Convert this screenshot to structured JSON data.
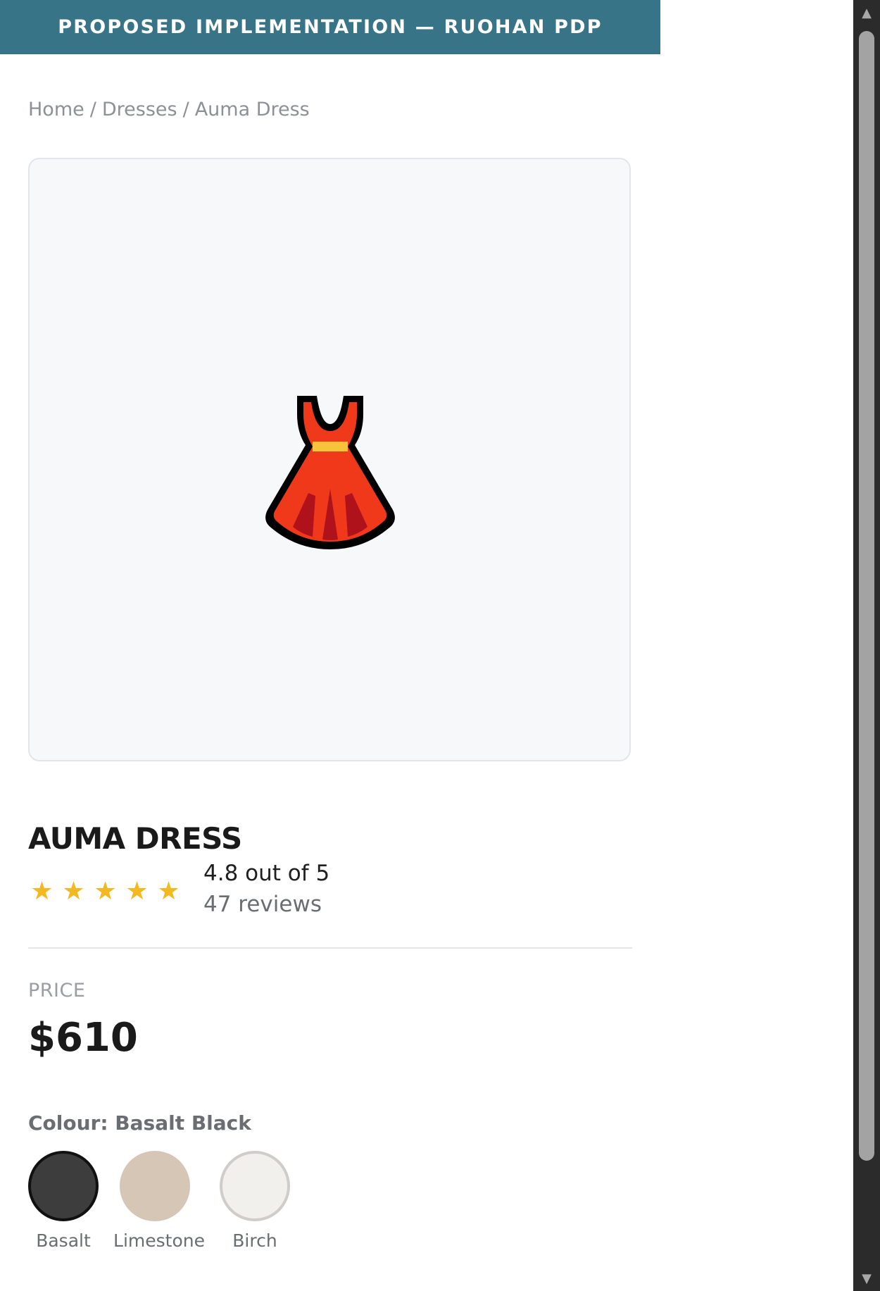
{
  "banner": {
    "text": "PROPOSED IMPLEMENTATION — RUOHAN PDP"
  },
  "breadcrumb": {
    "items": [
      "Home",
      "Dresses",
      "Auma Dress"
    ],
    "separator": "/"
  },
  "product": {
    "image_icon": "dress-icon",
    "title": "AUMA DRESS",
    "rating": {
      "stars": 5,
      "star_glyph": "★",
      "score_text": "4.8 out of 5",
      "count_text": "47 reviews"
    },
    "price": {
      "label": "PRICE",
      "value": "$610"
    },
    "colour": {
      "label": "Colour: Basalt Black",
      "options": [
        {
          "label": "Basalt",
          "color": "#3d3d3d",
          "selected": true
        },
        {
          "label": "Limestone",
          "color": "#d5c6b6",
          "selected": false
        },
        {
          "label": "Birch",
          "color": "#f2f0ed",
          "selected": false
        }
      ]
    }
  },
  "colors": {
    "banner_bg": "#387487",
    "star": "#f4b920"
  },
  "scrollbar": {
    "up_glyph": "▲",
    "down_glyph": "▼"
  }
}
